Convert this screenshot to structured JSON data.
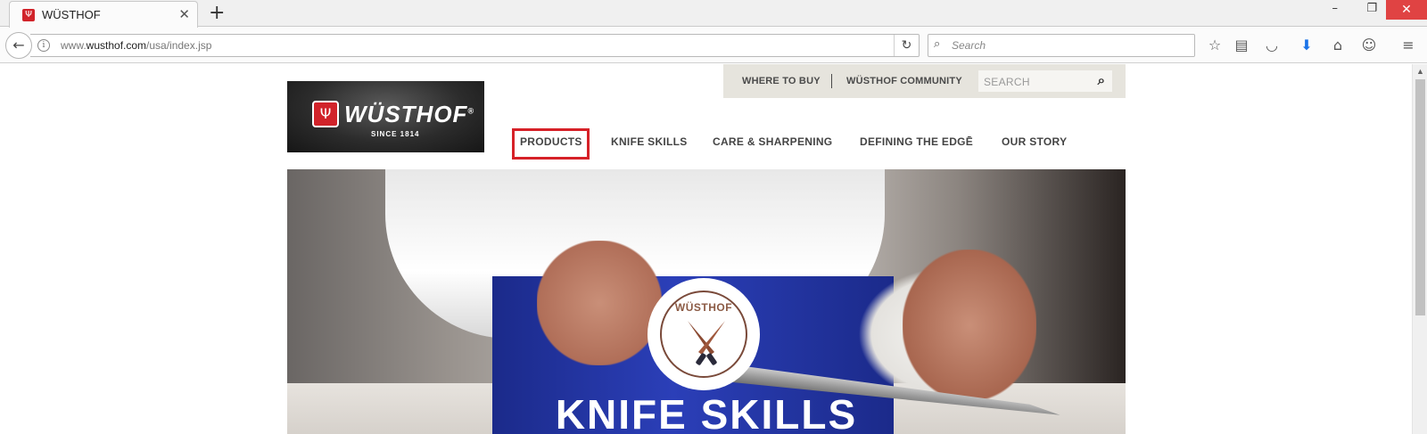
{
  "browser": {
    "tab_title": "WÜSTHOF",
    "url_prefix": "www.",
    "url_domain": "wusthof.com",
    "url_path": "/usa/index.jsp",
    "search_placeholder": "Search"
  },
  "utility_nav": {
    "where_to_buy": "WHERE TO BUY",
    "community": "WÜSTHOF COMMUNITY",
    "search_placeholder": "SEARCH"
  },
  "logo": {
    "wordmark": "WÜSTHOF",
    "trademark": "®",
    "since": "SINCE 1814"
  },
  "main_nav": {
    "items": [
      {
        "label": "PRODUCTS"
      },
      {
        "label": "KNIFE SKILLS"
      },
      {
        "label": "CARE & SHARPENING"
      },
      {
        "label": "DEFINING THE EDGĒ"
      },
      {
        "label": "OUR STORY"
      }
    ],
    "highlighted_item": "PRODUCTS",
    "highlight_color": "#d62128"
  },
  "hero": {
    "badge_word": "WÜSTHOF",
    "title": "KNIFE SKILLS"
  },
  "colors": {
    "brand_red": "#d1232a",
    "utility_bg": "#e6e4dd"
  }
}
